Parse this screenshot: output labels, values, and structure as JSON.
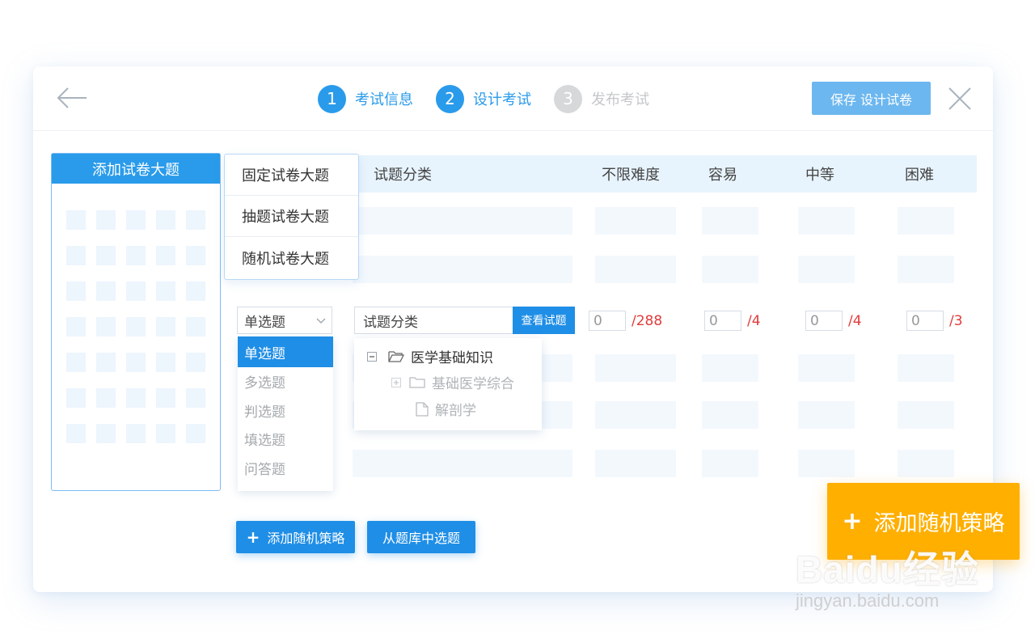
{
  "header": {
    "steps": [
      {
        "num": "1",
        "label": "考试信息"
      },
      {
        "num": "2",
        "label": "设计考试"
      },
      {
        "num": "3",
        "label": "发布考试"
      }
    ],
    "save_label": "保存 设计试卷"
  },
  "left_panel": {
    "title": "添加试卷大题"
  },
  "section_types": [
    "固定试卷大题",
    "抽题试卷大题",
    "随机试卷大题"
  ],
  "table": {
    "columns": [
      "试题分类",
      "不限难度",
      "容易",
      "中等",
      "困难"
    ]
  },
  "active_row": {
    "question_type": "单选题",
    "category_placeholder": "试题分类",
    "view_button": "查看试题",
    "counts": [
      {
        "value": "0",
        "max": "/288"
      },
      {
        "value": "0",
        "max": "/4"
      },
      {
        "value": "0",
        "max": "/4"
      },
      {
        "value": "0",
        "max": "/3"
      }
    ]
  },
  "question_type_options": [
    "单选题",
    "多选题",
    "判选题",
    "填选题",
    "问答题"
  ],
  "tree": {
    "root": "医学基础知识",
    "child_folder": "基础医学综合",
    "child_file": "解剖学"
  },
  "buttons": {
    "add_random": "添加随机策略",
    "from_bank": "从题库中选题",
    "callout": "添加随机策略"
  },
  "watermark": {
    "logo": "Baidu经验",
    "url": "jingyan.baidu.com"
  },
  "colors": {
    "primary": "#1f8ee6",
    "step_active": "#2a9bea",
    "step_inactive": "#d6d8da",
    "max_count": "#e23b3b",
    "callout": "#ffaf00"
  }
}
